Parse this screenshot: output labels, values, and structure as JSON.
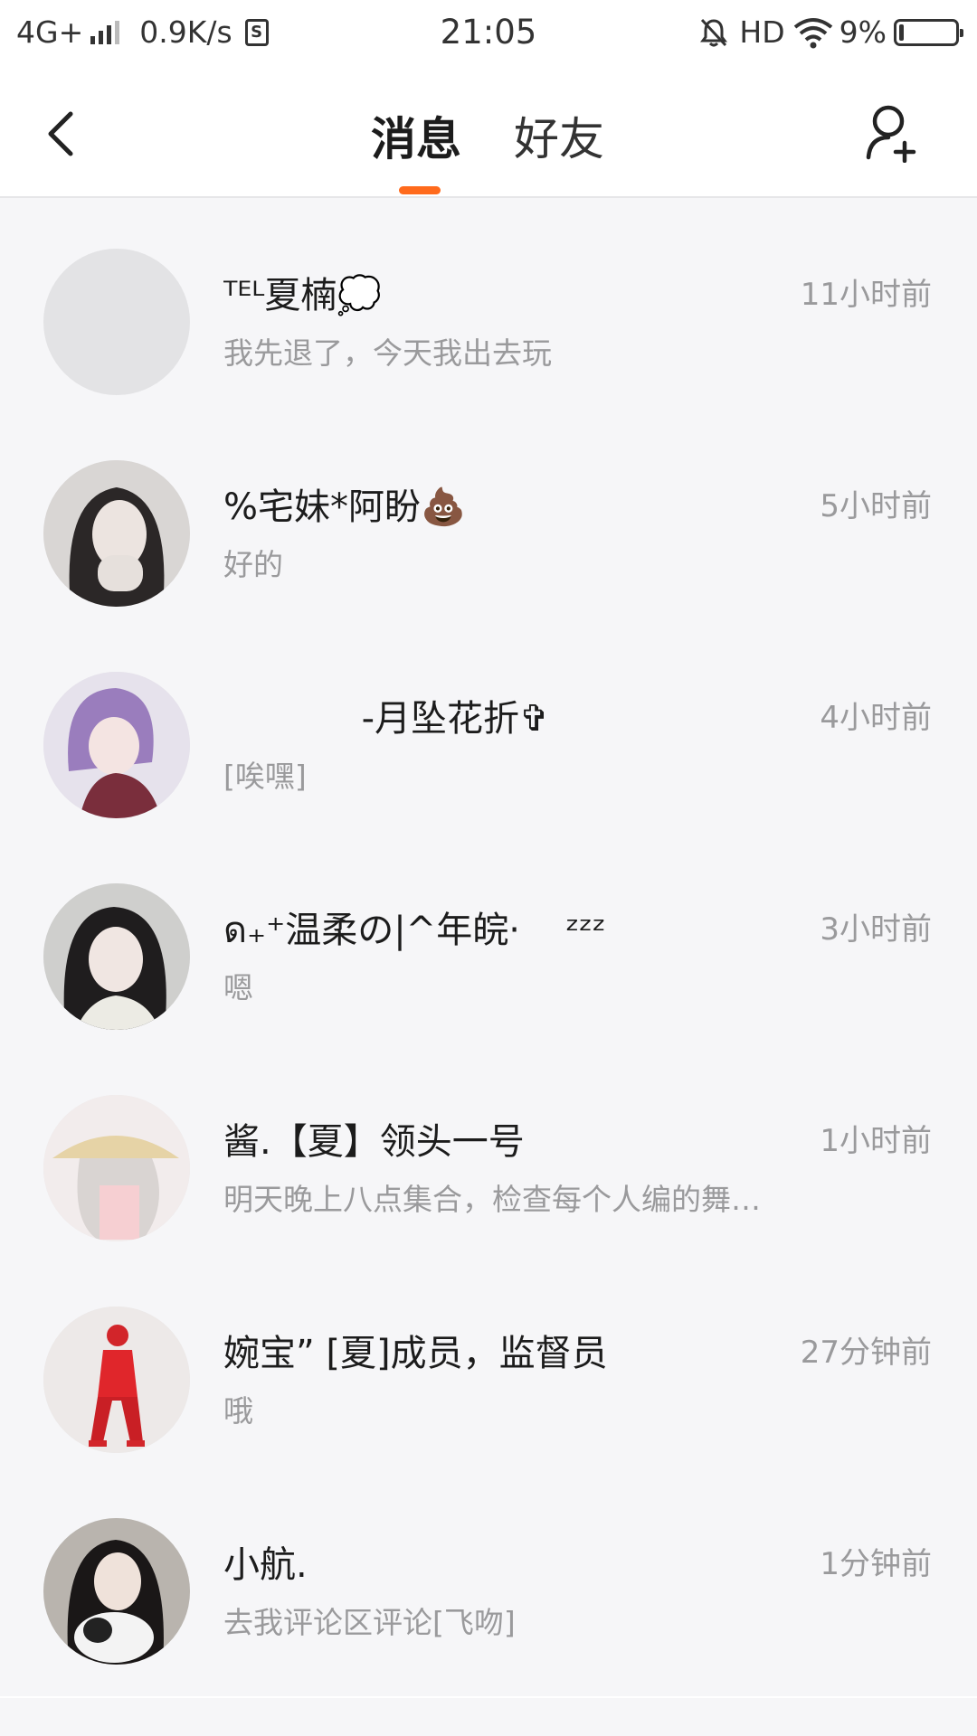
{
  "status_bar": {
    "network": "4G+",
    "speed": "0.9K/s",
    "sim_icon_label": "S",
    "time": "21:05",
    "hd": "HD",
    "battery_pct": "9%",
    "battery_level": 0.09
  },
  "header": {
    "tab_messages": "消息",
    "tab_friends": "好友",
    "active_tab": "messages",
    "accent_color": "#ff6a1c"
  },
  "conversations": [
    {
      "name": "ᵀᴱᴸ夏楠💭",
      "time": "11小时前",
      "preview": "我先退了，今天我出去玩",
      "avatar": "blank"
    },
    {
      "name": "%宅妹*阿盼💩",
      "time": "5小时前",
      "preview": "好的",
      "avatar": "photo-girl"
    },
    {
      "name": "            -月坠花折✞",
      "time": "4小时前",
      "preview": "[唉嘿]",
      "avatar": "anime-purple"
    },
    {
      "name": "ด₊⁺温柔の|^年皖·    ᶻᶻᶻ",
      "time": "3小时前",
      "preview": "嗯",
      "avatar": "photo-girl-2"
    },
    {
      "name": "酱.【夏】领头一号",
      "time": "1小时前",
      "preview": "明天晚上八点集合，检查每个人编的舞…",
      "avatar": "hat-girl"
    },
    {
      "name": "婉宝” [夏]成员，监督员",
      "time": "27分钟前",
      "preview": "哦",
      "avatar": "red-figure"
    },
    {
      "name": "小航.",
      "time": "1分钟前",
      "preview": "去我评论区评论[飞吻]",
      "avatar": "photo-cat"
    }
  ]
}
